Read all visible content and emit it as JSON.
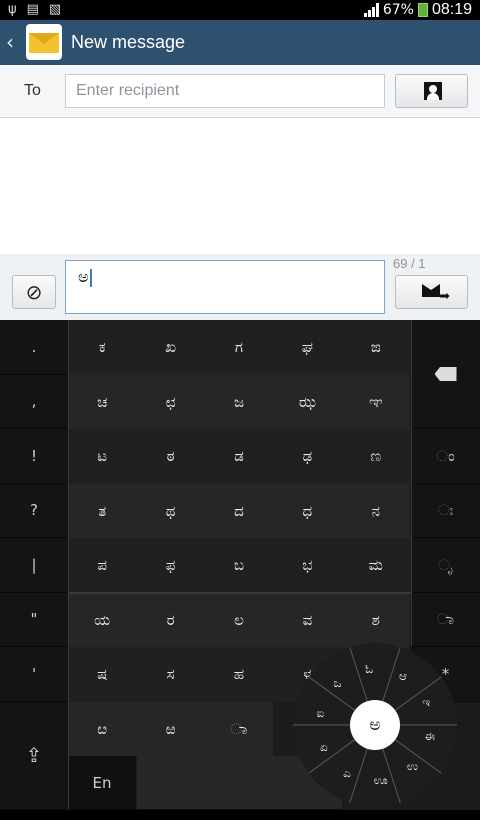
{
  "status": {
    "battery": "67%",
    "time": "08:19"
  },
  "appbar": {
    "title": "New message"
  },
  "recipient": {
    "label": "To",
    "placeholder": "Enter recipient"
  },
  "compose": {
    "text": "ಅ",
    "counter": "69 / 1"
  },
  "keyboard": {
    "left": [
      ".",
      ",",
      "!",
      "?",
      "|",
      "\"",
      "'",
      ""
    ],
    "rows": [
      [
        "ಕ",
        "ಖ",
        "ಗ",
        "ಘ",
        "ಙ"
      ],
      [
        "ಚ",
        "ಛ",
        "ಜ",
        "ಝ",
        "ಞ"
      ],
      [
        "ಟ",
        "ಠ",
        "ಡ",
        "ಢ",
        "ಣ"
      ],
      [
        "ತ",
        "ಥ",
        "ದ",
        "ಧ",
        "ನ"
      ],
      [
        "ಪ",
        "ಫ",
        "ಬ",
        "ಭ",
        "ಮ"
      ],
      [
        "ಯ",
        "ರ",
        "ಲ",
        "ವ",
        "ಶ"
      ],
      [
        "ಷ",
        "ಸ",
        "ಹ",
        "ಳ",
        ""
      ],
      [
        "ೞ",
        "ಱ",
        "ಾ",
        "",
        ""
      ]
    ],
    "right": [
      "",
      "ಂ",
      "ಃ",
      "ೃ",
      "ಾ",
      "*"
    ],
    "lang_label": "En",
    "wheel": {
      "center": "ಅ",
      "ring": [
        "ಆ",
        "ಇ",
        "ಈ",
        "ಉ",
        "ಊ",
        "ಎ",
        "ಏ",
        "ಐ",
        "ಒ",
        "ಓ"
      ]
    }
  },
  "colors": {
    "appbar": "#2f5170",
    "keyboard_bg": "#1b1b1b"
  }
}
